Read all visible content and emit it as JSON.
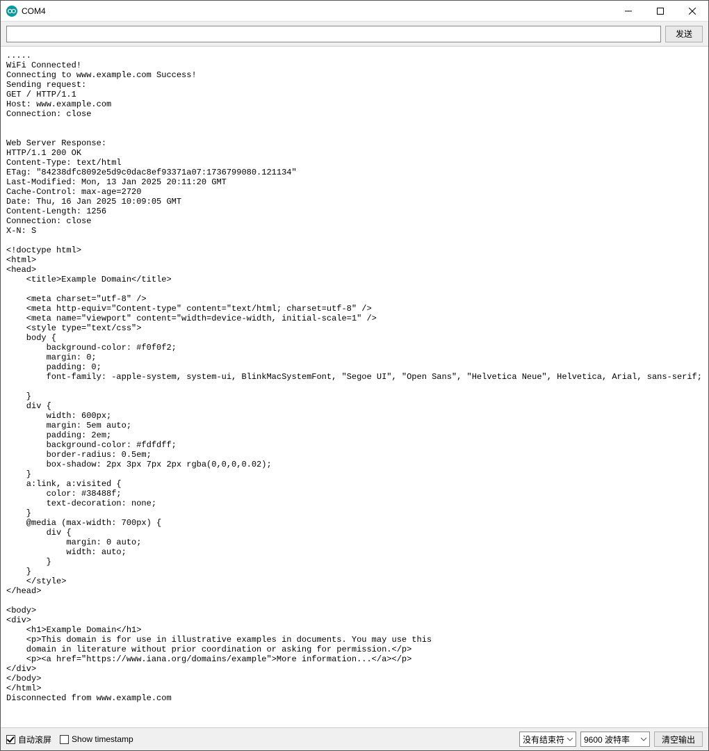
{
  "window": {
    "title": "COM4"
  },
  "toolbar": {
    "input_value": "",
    "send_label": "发送"
  },
  "output_text": ".....\nWiFi Connected!\nConnecting to www.example.com Success!\nSending request:\nGET / HTTP/1.1\nHost: www.example.com\nConnection: close\n\n\nWeb Server Response:\nHTTP/1.1 200 OK\nContent-Type: text/html\nETag: \"84238dfc8092e5d9c0dac8ef93371a07:1736799080.121134\"\nLast-Modified: Mon, 13 Jan 2025 20:11:20 GMT\nCache-Control: max-age=2720\nDate: Thu, 16 Jan 2025 10:09:05 GMT\nContent-Length: 1256\nConnection: close\nX-N: S\n\n<!doctype html>\n<html>\n<head>\n    <title>Example Domain</title>\n\n    <meta charset=\"utf-8\" />\n    <meta http-equiv=\"Content-type\" content=\"text/html; charset=utf-8\" />\n    <meta name=\"viewport\" content=\"width=device-width, initial-scale=1\" />\n    <style type=\"text/css\">\n    body {\n        background-color: #f0f0f2;\n        margin: 0;\n        padding: 0;\n        font-family: -apple-system, system-ui, BlinkMacSystemFont, \"Segoe UI\", \"Open Sans\", \"Helvetica Neue\", Helvetica, Arial, sans-serif;\n        \n    }\n    div {\n        width: 600px;\n        margin: 5em auto;\n        padding: 2em;\n        background-color: #fdfdff;\n        border-radius: 0.5em;\n        box-shadow: 2px 3px 7px 2px rgba(0,0,0,0.02);\n    }\n    a:link, a:visited {\n        color: #38488f;\n        text-decoration: none;\n    }\n    @media (max-width: 700px) {\n        div {\n            margin: 0 auto;\n            width: auto;\n        }\n    }\n    </style>    \n</head>\n\n<body>\n<div>\n    <h1>Example Domain</h1>\n    <p>This domain is for use in illustrative examples in documents. You may use this\n    domain in literature without prior coordination or asking for permission.</p>\n    <p><a href=\"https://www.iana.org/domains/example\">More information...</a></p>\n</div>\n</body>\n</html>\nDisconnected from www.example.com\n",
  "statusbar": {
    "autoscroll_label": "自动滚屏",
    "autoscroll_checked": true,
    "timestamp_label": "Show timestamp",
    "timestamp_checked": false,
    "line_ending_selected": "没有结束符",
    "baud_selected": "9600 波特率",
    "clear_label": "清空输出"
  }
}
